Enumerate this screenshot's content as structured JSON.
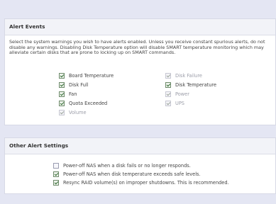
{
  "alert_events": {
    "title": "Alert Events",
    "description": "Select the system warnings you wish to have alerts enabled. Unless you receive constant spurious alerts, do not disable any warnings. Disabling Disk Temperature option will disable SMART temperature monitoring which may alleviate certain disks that are prone to locking up on SMART commands.",
    "left": [
      {
        "label": "Board Temperature",
        "checked": true,
        "disabled": false
      },
      {
        "label": "Disk Full",
        "checked": true,
        "disabled": false
      },
      {
        "label": "Fan",
        "checked": true,
        "disabled": false
      },
      {
        "label": "Quota Exceeded",
        "checked": true,
        "disabled": false
      },
      {
        "label": "Volume",
        "checked": true,
        "disabled": true
      }
    ],
    "right": [
      {
        "label": "Disk Failure",
        "checked": true,
        "disabled": true
      },
      {
        "label": "Disk Temperature",
        "checked": true,
        "disabled": false
      },
      {
        "label": "Power",
        "checked": true,
        "disabled": true
      },
      {
        "label": "UPS",
        "checked": true,
        "disabled": true
      }
    ]
  },
  "other_alert_settings": {
    "title": "Other Alert Settings",
    "options": [
      {
        "label": "Power-off NAS when a disk fails or no longer responds.",
        "checked": false,
        "disabled": false
      },
      {
        "label": "Power-off NAS when disk temperature exceeds safe levels.",
        "checked": true,
        "disabled": false
      },
      {
        "label": "Resync RAID volume(s) on improper shutdowns. This is recommended.",
        "checked": true,
        "disabled": false
      }
    ]
  }
}
